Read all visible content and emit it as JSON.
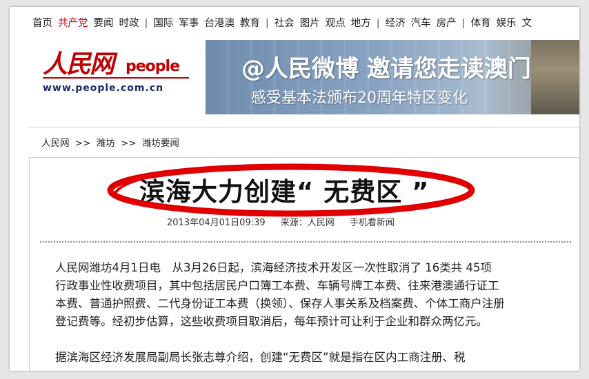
{
  "nav": {
    "items": [
      {
        "label": "首页",
        "style": "normal"
      },
      {
        "label": "共产党",
        "style": "red"
      },
      {
        "label": "要闻",
        "style": "normal"
      },
      {
        "label": "时政",
        "style": "normal"
      },
      {
        "label": "|",
        "style": "sep"
      },
      {
        "label": "国际",
        "style": "normal"
      },
      {
        "label": "军事",
        "style": "normal"
      },
      {
        "label": "台港澳",
        "style": "normal"
      },
      {
        "label": "教育",
        "style": "normal"
      },
      {
        "label": "|",
        "style": "sep"
      },
      {
        "label": "社会",
        "style": "normal"
      },
      {
        "label": "图片",
        "style": "normal"
      },
      {
        "label": "观点",
        "style": "normal"
      },
      {
        "label": "地方",
        "style": "normal"
      },
      {
        "label": "|",
        "style": "sep"
      },
      {
        "label": "经济",
        "style": "normal"
      },
      {
        "label": "汽车",
        "style": "normal"
      },
      {
        "label": "房产",
        "style": "normal"
      },
      {
        "label": "|",
        "style": "sep"
      },
      {
        "label": "体育",
        "style": "normal"
      },
      {
        "label": "娱乐",
        "style": "normal"
      },
      {
        "label": "文",
        "style": "normal"
      }
    ]
  },
  "logo": {
    "brand": "人民网",
    "people": "people",
    "url": "www.people.com.cn"
  },
  "banner": {
    "headline": "@人民微博 邀请您走读澳门",
    "subline": "感受基本法颁布20周年特区变化"
  },
  "breadcrumb": {
    "items": [
      "人民网",
      ">>",
      "潍坊",
      ">>",
      "潍坊要闻"
    ]
  },
  "article": {
    "title": "滨海大力创建“ 无费区 ”",
    "date": "2013年04月01日09:39",
    "source": "来源：人民网",
    "mobile": "手机看新闻",
    "para1": [
      "人民网潍坊4月1日电　从3月26日起，滨海经济技术开发区一次性取消了 16类共 45项",
      "行政事业性收费项目，其中包括居民户口簿工本费、车辆号牌工本费、往来港澳通行证工",
      "本费、普通护照费、二代身份证工本费（换领）、保存人事关系及档案费、个体工商户注册",
      "登记费等。经初步估算，这些收费项目取消后，每年预计可让利于企业和群众两亿元。"
    ],
    "para2": [
      "据滨海区经济发展局副局长张志尊介绍，创建“无费区”就是指在区内工商注册、税"
    ]
  },
  "colors": {
    "nav_red": "#c40000",
    "ellipse_red": "#e00000"
  }
}
